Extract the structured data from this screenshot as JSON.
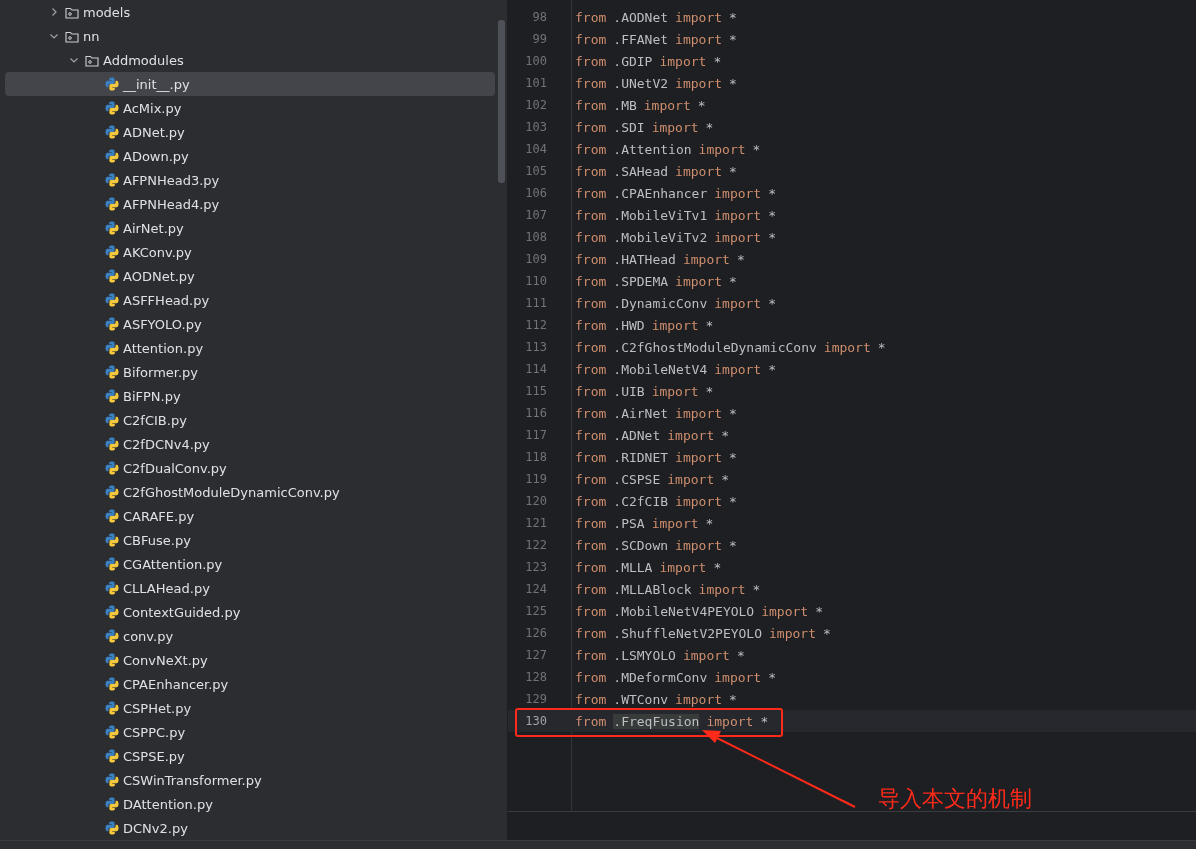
{
  "project_tree": {
    "items": [
      {
        "kind": "folder",
        "label": "models",
        "expanded": false,
        "selected": false
      },
      {
        "kind": "folder",
        "label": "nn",
        "expanded": true,
        "selected": false,
        "children": [
          {
            "kind": "folder",
            "label": "Addmodules",
            "expanded": true,
            "selected": false,
            "children": [
              {
                "kind": "python",
                "label": "__init__.py",
                "selected": true
              },
              {
                "kind": "python",
                "label": "AcMix.py",
                "selected": false
              },
              {
                "kind": "python",
                "label": "ADNet.py",
                "selected": false
              },
              {
                "kind": "python",
                "label": "ADown.py",
                "selected": false
              },
              {
                "kind": "python",
                "label": "AFPNHead3.py",
                "selected": false
              },
              {
                "kind": "python",
                "label": "AFPNHead4.py",
                "selected": false
              },
              {
                "kind": "python",
                "label": "AirNet.py",
                "selected": false
              },
              {
                "kind": "python",
                "label": "AKConv.py",
                "selected": false
              },
              {
                "kind": "python",
                "label": "AODNet.py",
                "selected": false
              },
              {
                "kind": "python",
                "label": "ASFFHead.py",
                "selected": false
              },
              {
                "kind": "python",
                "label": "ASFYOLO.py",
                "selected": false
              },
              {
                "kind": "python",
                "label": "Attention.py",
                "selected": false
              },
              {
                "kind": "python",
                "label": "Biformer.py",
                "selected": false
              },
              {
                "kind": "python",
                "label": "BiFPN.py",
                "selected": false
              },
              {
                "kind": "python",
                "label": "C2fCIB.py",
                "selected": false
              },
              {
                "kind": "python",
                "label": "C2fDCNv4.py",
                "selected": false
              },
              {
                "kind": "python",
                "label": "C2fDualConv.py",
                "selected": false
              },
              {
                "kind": "python",
                "label": "C2fGhostModuleDynamicConv.py",
                "selected": false
              },
              {
                "kind": "python",
                "label": "CARAFE.py",
                "selected": false
              },
              {
                "kind": "python",
                "label": "CBFuse.py",
                "selected": false
              },
              {
                "kind": "python",
                "label": "CGAttention.py",
                "selected": false
              },
              {
                "kind": "python",
                "label": "CLLAHead.py",
                "selected": false
              },
              {
                "kind": "python",
                "label": "ContextGuided.py",
                "selected": false
              },
              {
                "kind": "python",
                "label": "conv.py",
                "selected": false
              },
              {
                "kind": "python",
                "label": "ConvNeXt.py",
                "selected": false
              },
              {
                "kind": "python",
                "label": "CPAEnhancer.py",
                "selected": false
              },
              {
                "kind": "python",
                "label": "CSPHet.py",
                "selected": false
              },
              {
                "kind": "python",
                "label": "CSPPC.py",
                "selected": false
              },
              {
                "kind": "python",
                "label": "CSPSE.py",
                "selected": false
              },
              {
                "kind": "python",
                "label": "CSWinTransformer.py",
                "selected": false
              },
              {
                "kind": "python",
                "label": "DAttention.py",
                "selected": false
              },
              {
                "kind": "python",
                "label": "DCNv2.py",
                "selected": false
              }
            ]
          }
        ]
      }
    ]
  },
  "editor": {
    "lines": [
      {
        "number": "98",
        "from": "from",
        "module": ".AODNet",
        "import": "import",
        "star": "*",
        "current": false
      },
      {
        "number": "99",
        "from": "from",
        "module": ".FFANet",
        "import": "import",
        "star": "*",
        "current": false
      },
      {
        "number": "100",
        "from": "from",
        "module": ".GDIP",
        "import": "import",
        "star": "*",
        "current": false
      },
      {
        "number": "101",
        "from": "from",
        "module": ".UNetV2",
        "import": "import",
        "star": "*",
        "current": false
      },
      {
        "number": "102",
        "from": "from",
        "module": ".MB",
        "import": "import",
        "star": "*",
        "current": false
      },
      {
        "number": "103",
        "from": "from",
        "module": ".SDI",
        "import": "import",
        "star": "*",
        "current": false
      },
      {
        "number": "104",
        "from": "from",
        "module": ".Attention",
        "import": "import",
        "star": "*",
        "current": false
      },
      {
        "number": "105",
        "from": "from",
        "module": ".SAHead",
        "import": "import",
        "star": "*",
        "current": false
      },
      {
        "number": "106",
        "from": "from",
        "module": ".CPAEnhancer",
        "import": "import",
        "star": "*",
        "current": false
      },
      {
        "number": "107",
        "from": "from",
        "module": ".MobileViTv1",
        "import": "import",
        "star": "*",
        "current": false
      },
      {
        "number": "108",
        "from": "from",
        "module": ".MobileViTv2",
        "import": "import",
        "star": "*",
        "current": false
      },
      {
        "number": "109",
        "from": "from",
        "module": ".HATHead",
        "import": "import",
        "star": "*",
        "current": false
      },
      {
        "number": "110",
        "from": "from",
        "module": ".SPDEMA",
        "import": "import",
        "star": "*",
        "current": false
      },
      {
        "number": "111",
        "from": "from",
        "module": ".DynamicConv",
        "import": "import",
        "star": "*",
        "current": false
      },
      {
        "number": "112",
        "from": "from",
        "module": ".HWD",
        "import": "import",
        "star": "*",
        "current": false
      },
      {
        "number": "113",
        "from": "from",
        "module": ".C2fGhostModuleDynamicConv",
        "import": "import",
        "star": "*",
        "current": false
      },
      {
        "number": "114",
        "from": "from",
        "module": ".MobileNetV4",
        "import": "import",
        "star": "*",
        "current": false
      },
      {
        "number": "115",
        "from": "from",
        "module": ".UIB",
        "import": "import",
        "star": "*",
        "current": false
      },
      {
        "number": "116",
        "from": "from",
        "module": ".AirNet",
        "import": "import",
        "star": "*",
        "current": false
      },
      {
        "number": "117",
        "from": "from",
        "module": ".ADNet",
        "import": "import",
        "star": "*",
        "current": false
      },
      {
        "number": "118",
        "from": "from",
        "module": ".RIDNET",
        "import": "import",
        "star": "*",
        "current": false
      },
      {
        "number": "119",
        "from": "from",
        "module": ".CSPSE",
        "import": "import",
        "star": "*",
        "current": false
      },
      {
        "number": "120",
        "from": "from",
        "module": ".C2fCIB",
        "import": "import",
        "star": "*",
        "current": false
      },
      {
        "number": "121",
        "from": "from",
        "module": ".PSA",
        "import": "import",
        "star": "*",
        "current": false
      },
      {
        "number": "122",
        "from": "from",
        "module": ".SCDown",
        "import": "import",
        "star": "*",
        "current": false
      },
      {
        "number": "123",
        "from": "from",
        "module": ".MLLA",
        "import": "import",
        "star": "*",
        "current": false
      },
      {
        "number": "124",
        "from": "from",
        "module": ".MLLABlock",
        "import": "import",
        "star": "*",
        "current": false
      },
      {
        "number": "125",
        "from": "from",
        "module": ".MobileNetV4PEYOLO",
        "import": "import",
        "star": "*",
        "current": false
      },
      {
        "number": "126",
        "from": "from",
        "module": ".ShuffleNetV2PEYOLO",
        "import": "import",
        "star": "*",
        "current": false
      },
      {
        "number": "127",
        "from": "from",
        "module": ".LSMYOLO",
        "import": "import",
        "star": "*",
        "current": false
      },
      {
        "number": "128",
        "from": "from",
        "module": ".MDeformConv",
        "import": "import",
        "star": "*",
        "current": false
      },
      {
        "number": "129",
        "from": "from",
        "module": ".WTConv",
        "import": "import",
        "star": "*",
        "current": false
      },
      {
        "number": "130",
        "from": "from",
        "module": ".FreqFusion",
        "import": "import",
        "star": "*",
        "current": true
      }
    ]
  },
  "annotation": {
    "text": "导入本文的机制"
  }
}
